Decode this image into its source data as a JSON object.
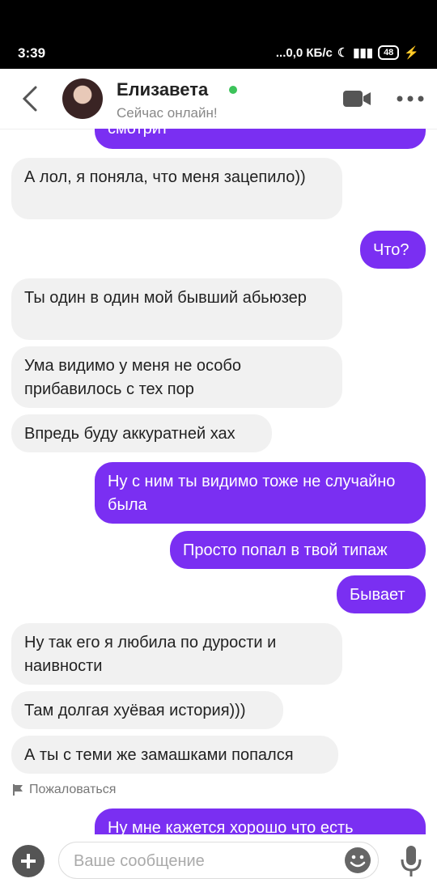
{
  "statusbar": {
    "time": "3:39",
    "net": "...0,0 КБ/с",
    "battery": "48"
  },
  "header": {
    "name": "Елизавета",
    "status": "Сейчас онлайн!"
  },
  "messages": [
    {
      "dir": "out",
      "text": "смотрит"
    },
    {
      "dir": "in",
      "text": "А лол, я поняла, что меня зацепило))"
    },
    {
      "dir": "out",
      "text": "Что?"
    },
    {
      "dir": "in",
      "text": "Ты один в один мой бывший абьюзер"
    },
    {
      "dir": "in",
      "text": "Ума видимо у меня не особо прибавилось с тех пор"
    },
    {
      "dir": "in",
      "text": "Впредь буду аккуратней хах"
    },
    {
      "dir": "out",
      "text": "Ну с ним ты видимо тоже не случайно была"
    },
    {
      "dir": "out",
      "text": "Просто попал в твой типаж"
    },
    {
      "dir": "out",
      "text": "Бывает"
    },
    {
      "dir": "in",
      "text": "Ну так его я любила по дурости и наивности"
    },
    {
      "dir": "in",
      "text": "Там долгая хуёвая история)))"
    },
    {
      "dir": "in",
      "text": "А ты с теми же замашками попался"
    },
    {
      "dir": "out",
      "text": "Ну мне кажется хорошо что есть"
    }
  ],
  "report": {
    "label": "Пожаловаться"
  },
  "input": {
    "placeholder": "Ваше сообщение"
  },
  "colors": {
    "accent": "#7a2ff2",
    "incoming": "#f1f1f1",
    "online": "#3cc35a"
  }
}
